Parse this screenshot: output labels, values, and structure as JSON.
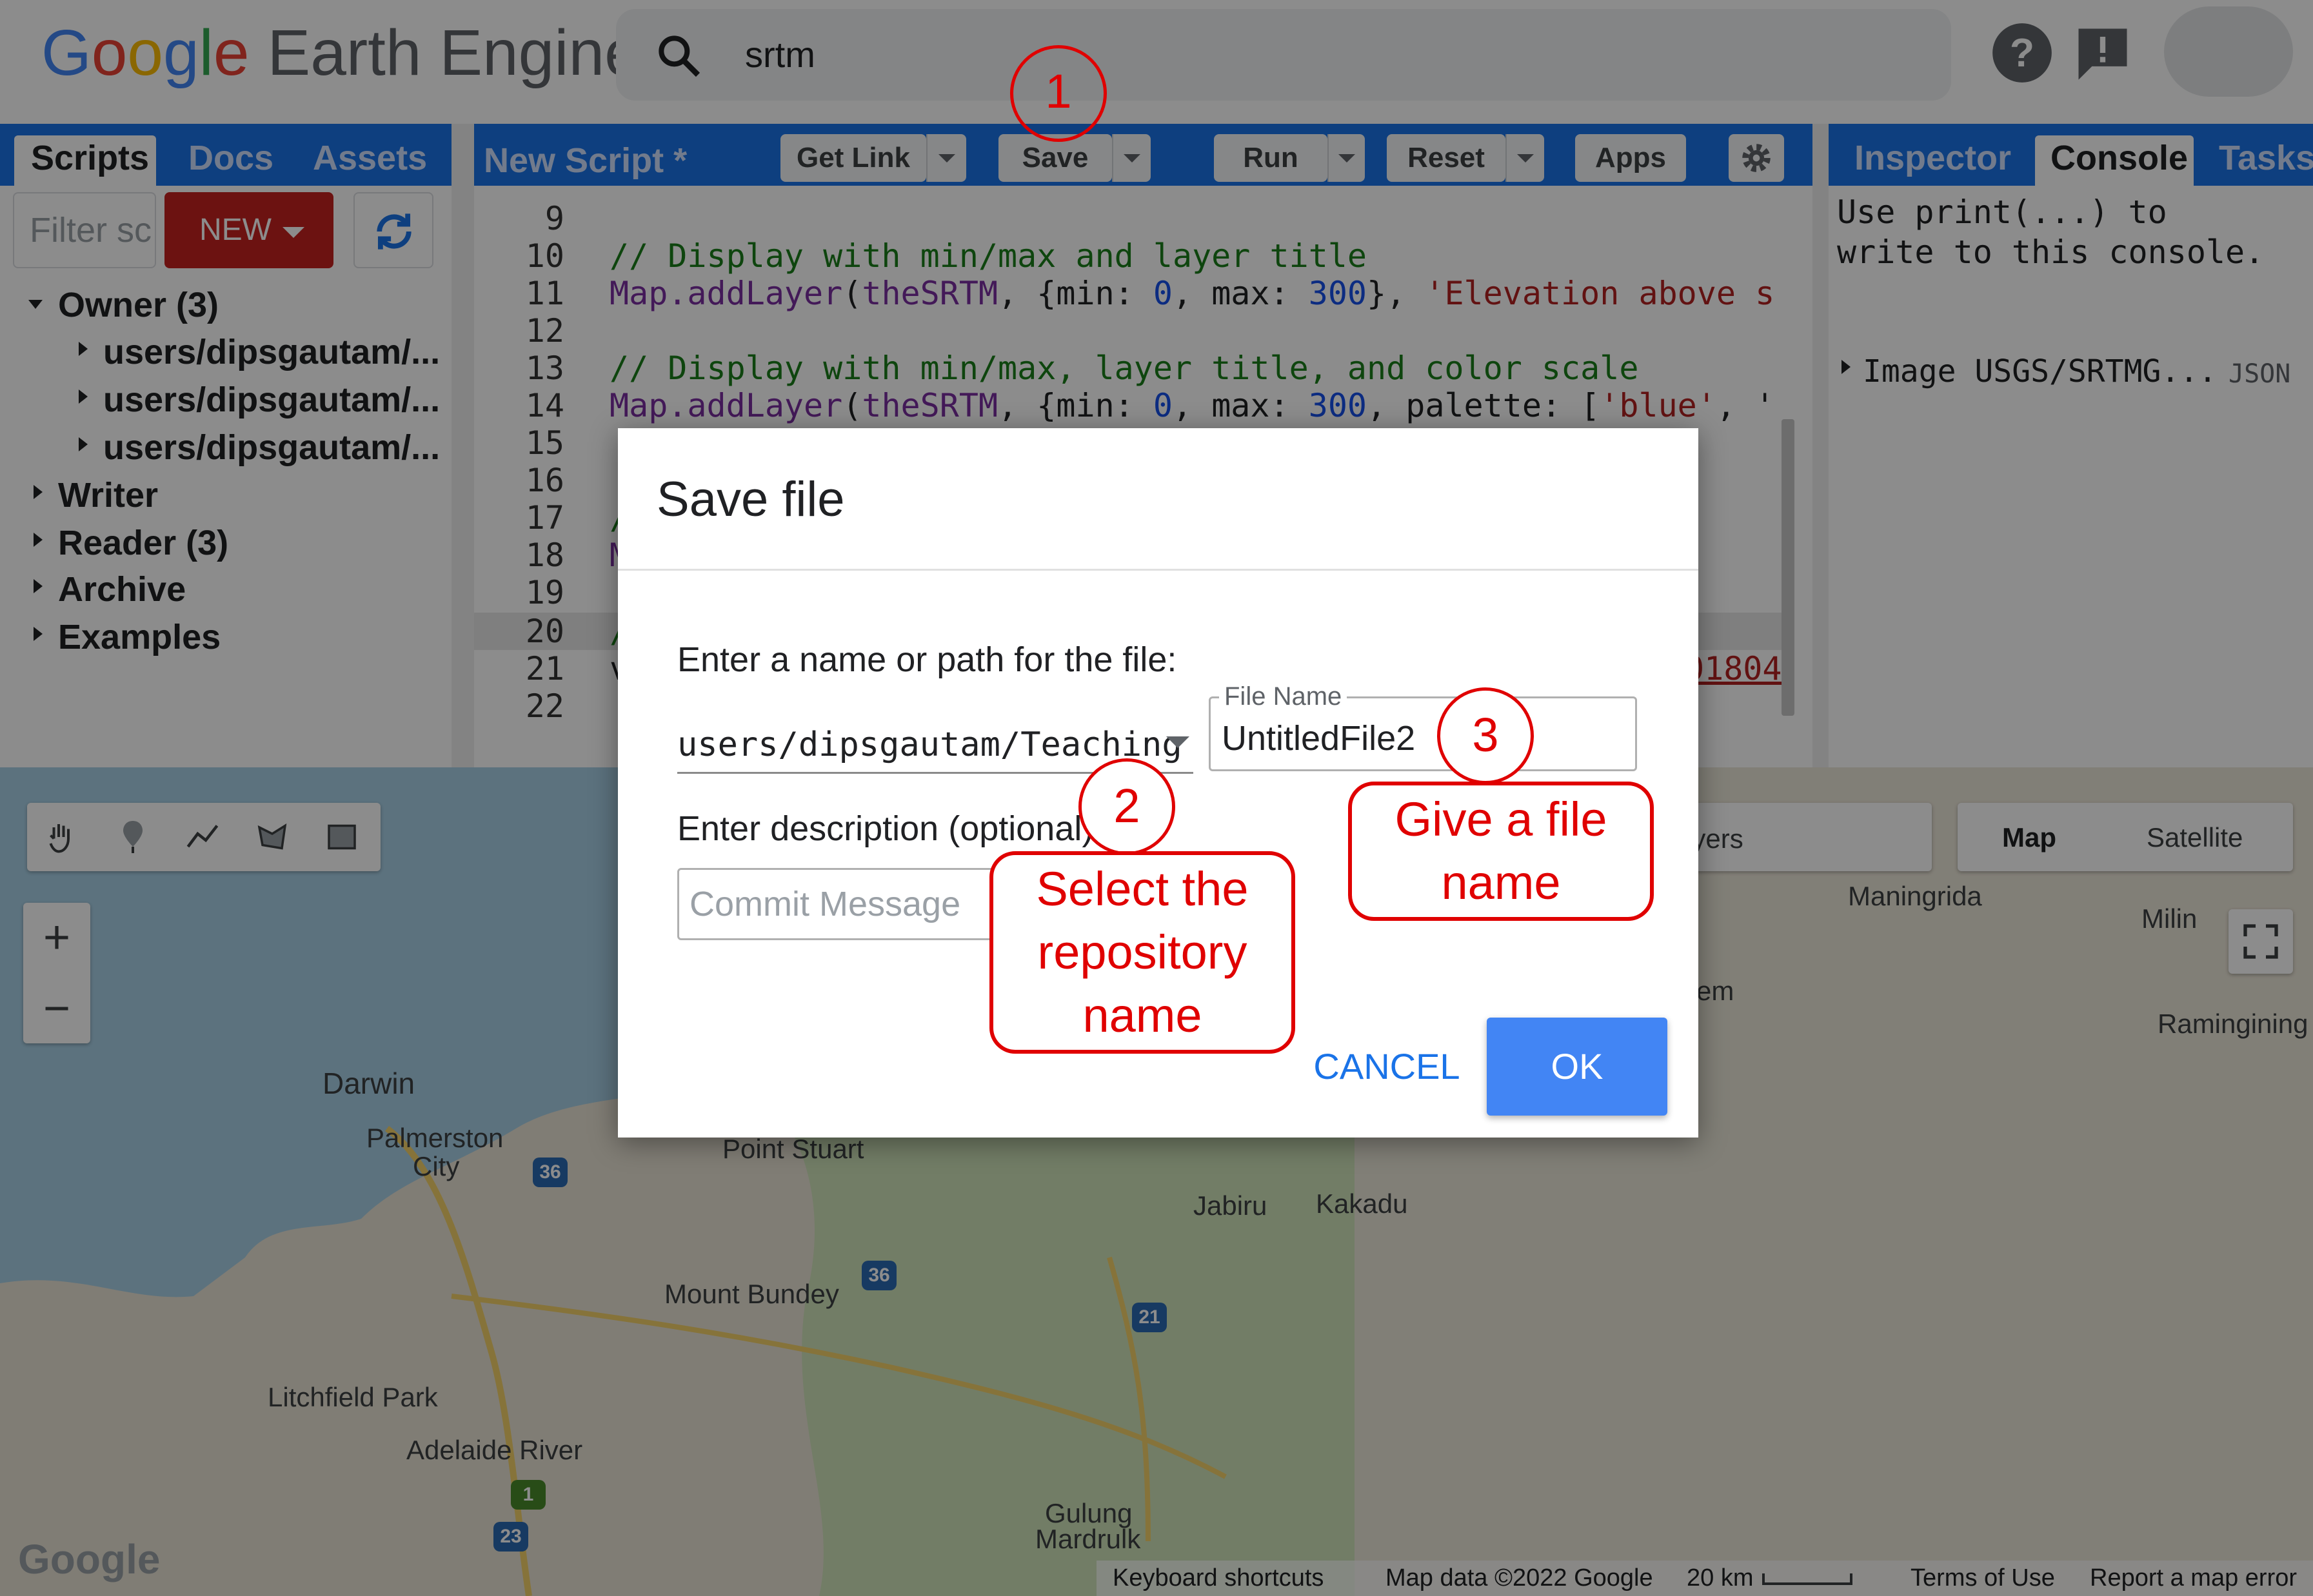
{
  "header": {
    "logo_google": [
      "G",
      "o",
      "o",
      "g",
      "l",
      "e"
    ],
    "logo_product": "Earth Engine",
    "search_value": "srtm"
  },
  "left_panel": {
    "tabs": [
      "Scripts",
      "Docs",
      "Assets"
    ],
    "filter_placeholder": "Filter sc",
    "new_label": "NEW",
    "tree": [
      {
        "label": "Owner (3)"
      },
      {
        "label": "users/dipsgautam/..."
      },
      {
        "label": "users/dipsgautam/..."
      },
      {
        "label": "users/dipsgautam/..."
      },
      {
        "label": "Writer"
      },
      {
        "label": "Reader (3)"
      },
      {
        "label": "Archive"
      },
      {
        "label": "Examples"
      }
    ]
  },
  "editor": {
    "title": "New Script *",
    "buttons": {
      "get_link": "Get Link",
      "save": "Save",
      "run": "Run",
      "reset": "Reset",
      "apps": "Apps"
    },
    "line_numbers": [
      "9",
      "10",
      "11",
      "12",
      "13",
      "14",
      "15",
      "16",
      "17",
      "18",
      "19",
      "20",
      "21",
      "22"
    ],
    "code": {
      "l10": "// Display with min/max and layer title",
      "l11_a": "Map.addLayer",
      "l11_b": "(",
      "l11_c": "theSRTM",
      "l11_d": ", {min: ",
      "l11_e": "0",
      "l11_f": ", max: ",
      "l11_g": "300",
      "l11_h": "}, ",
      "l11_i": "'Elevation above s",
      "l13": "// Display with min/max, layer title, and color scale",
      "l14_a": "Map.addLayer",
      "l14_b": "(",
      "l14_c": "theSRTM",
      "l14_d": ", {min: ",
      "l14_e": "0",
      "l14_f": ", max: ",
      "l14_g": "300",
      "l14_h": ", palette: [",
      "l14_i": "'blue'",
      "l14_j": ", '",
      "frag_17": "/",
      "frag_18": "M",
      "frag_20": "/",
      "frag_21": "v",
      "frag_21_end": "01804"
    }
  },
  "right_panel": {
    "tabs": [
      "Inspector",
      "Console",
      "Tasks"
    ],
    "console_hint": "Use print(...) to\nwrite to this console.",
    "console_item": "Image USGS/SRTMG...",
    "console_json": "JSON"
  },
  "map": {
    "type_buttons": [
      "Map",
      "Satellite"
    ],
    "layers_fragment": "ayers",
    "zoom_in": "+",
    "zoom_out": "−",
    "places": {
      "maningrida": "Maningrida",
      "milin": "Milin",
      "ramingining": "Ramingining",
      "em": "em",
      "darwin": "Darwin",
      "palmerston": "Palmerston",
      "city": "City",
      "point_stuart": "Point Stuart",
      "jabiru": "Jabiru",
      "kakadu": "Kakadu",
      "mount_bundey": "Mount Bundey",
      "litchfield": "Litchfield Park",
      "adelaide": "Adelaide River",
      "gulung1": "Gulung",
      "gulung2": "Mardrulk"
    },
    "shields": {
      "s36a": "36",
      "s36b": "36",
      "s21": "21",
      "s1": "1",
      "s23": "23"
    },
    "google_mark": "Google",
    "footer": {
      "shortcuts": "Keyboard shortcuts",
      "mapdata": "Map data ©2022 Google",
      "scale": "20 km",
      "terms": "Terms of Use",
      "report": "Report a map error"
    }
  },
  "dialog": {
    "title": "Save file",
    "path_prompt": "Enter a name or path for the file:",
    "repository": "users/dipsgautam/Teaching",
    "file_name_label": "File Name",
    "file_name_value": "UntitledFile2",
    "description_prompt": "Enter description (optional):",
    "commit_placeholder": "Commit Message",
    "cancel_label": "CANCEL",
    "ok_label": "OK"
  },
  "annotations": {
    "n1": "1",
    "n2": "2",
    "n3": "3",
    "callout_repo": "Select the repository name",
    "callout_file": "Give a file name",
    "accent_color": "#e00000"
  },
  "colors": {
    "brand_blue": "#1a73e8",
    "new_red": "#c5221f",
    "ok_blue": "#4285f4"
  }
}
